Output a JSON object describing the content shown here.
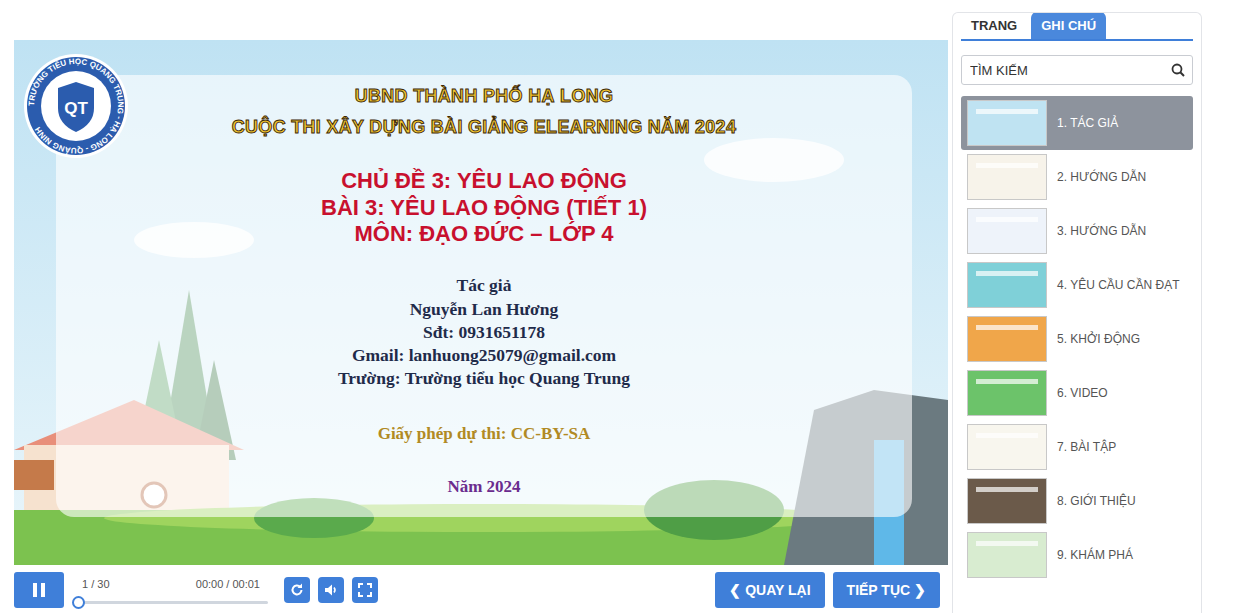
{
  "slide": {
    "logo": {
      "ring_text": "TRƯỜNG TIỂU HỌC QUANG TRUNG - HẠ LONG - QUẢNG NINH",
      "initials": "QT"
    },
    "organization": "UBND THÀNH PHỐ HẠ LONG",
    "contest": "CUỘC THI XÂY DỰNG BÀI GIẢNG ELEARNING NĂM 2024",
    "topic": "CHỦ ĐỀ 3: YÊU LAO ĐỘNG",
    "lesson": "BÀI 3: YÊU LAO ĐỘNG (TIẾT 1)",
    "subject": "MÔN: ĐẠO ĐỨC – LỚP 4",
    "author_label": "Tác giả",
    "author": "Nguyễn Lan Hương",
    "phone": "Sđt: 0931651178",
    "email": "Gmail: lanhuong25079@gmail.com",
    "school": "Trường: Trường tiểu học Quang Trung",
    "license": "Giấy phép dự thi: CC-BY-SA",
    "year": "Năm 2024"
  },
  "player": {
    "playing": true,
    "slide_counter": "1 / 30",
    "time": "00:00 / 00:01",
    "progress": {
      "level": 0
    },
    "prev_button": "❮ QUAY LẠI",
    "next_button": "TIẾP TỤC ❯"
  },
  "sidebar": {
    "tabs": [
      {
        "label": "TRANG",
        "selected": false
      },
      {
        "label": "GHI CHÚ",
        "selected": true
      }
    ],
    "search": {
      "placeholder": "TÌM KIẾM"
    },
    "items": [
      {
        "label": "1. TÁC GIẢ",
        "selected": true,
        "color": "#bfe3f2"
      },
      {
        "label": "2. HƯỚNG DẪN",
        "selected": false,
        "color": "#f7f3ea"
      },
      {
        "label": "3. HƯỚNG DẪN",
        "selected": false,
        "color": "#eef3fa"
      },
      {
        "label": "4. YÊU CẦU CẦN ĐẠT",
        "selected": false,
        "color": "#7fd0d8"
      },
      {
        "label": "5. KHỞI ĐỘNG",
        "selected": false,
        "color": "#f0a64a"
      },
      {
        "label": "6. VIDEO",
        "selected": false,
        "color": "#6cc36a"
      },
      {
        "label": "7. BÀI TẬP",
        "selected": false,
        "color": "#f8f6ee"
      },
      {
        "label": "8. GIỚI THIỆU",
        "selected": false,
        "color": "#6b5a4a"
      },
      {
        "label": "9. KHÁM PHÁ",
        "selected": false,
        "color": "#d8ecd0"
      }
    ]
  }
}
